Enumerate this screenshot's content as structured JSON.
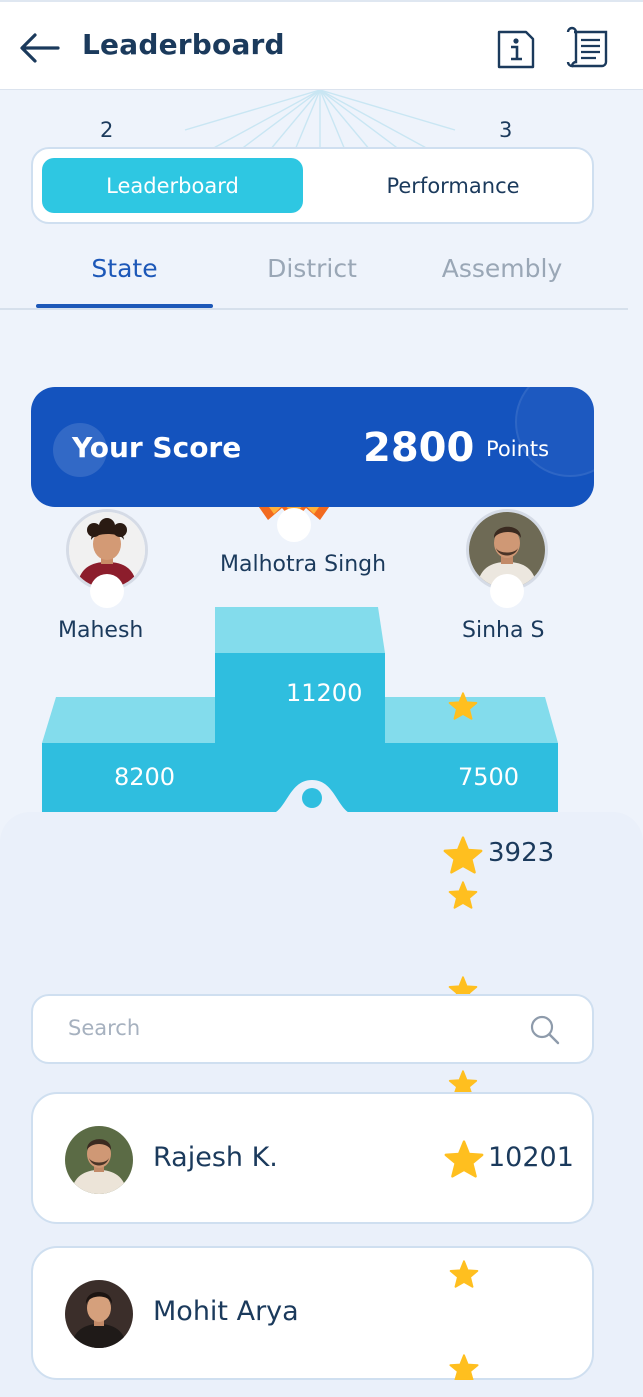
{
  "header": {
    "title": "Leaderboard"
  },
  "rank_labels": {
    "left": "2",
    "right": "3"
  },
  "toggle": {
    "active": "Leaderboard",
    "other": "Performance"
  },
  "tabs": [
    {
      "label": "State",
      "active": true
    },
    {
      "label": "District",
      "active": false
    },
    {
      "label": "Assembly",
      "active": false
    }
  ],
  "your_score": {
    "label": "Your Score",
    "value": "2800",
    "unit": "Points"
  },
  "podium": {
    "first": {
      "name": "Malhotra Singh",
      "points": "11200"
    },
    "second": {
      "name": "Mahesh",
      "points": "8200"
    },
    "third": {
      "name": "Sinha S",
      "points": "7500"
    }
  },
  "highlight_points": "3923",
  "search": {
    "placeholder": "Search"
  },
  "list": [
    {
      "name": "Rajesh K.",
      "points": "10201"
    },
    {
      "name": "Mohit Arya",
      "points": ""
    }
  ],
  "colors": {
    "accent": "#2ec7e2",
    "primary": "#1453be",
    "star": "#ffbf1f",
    "text": "#1b3a5c"
  }
}
